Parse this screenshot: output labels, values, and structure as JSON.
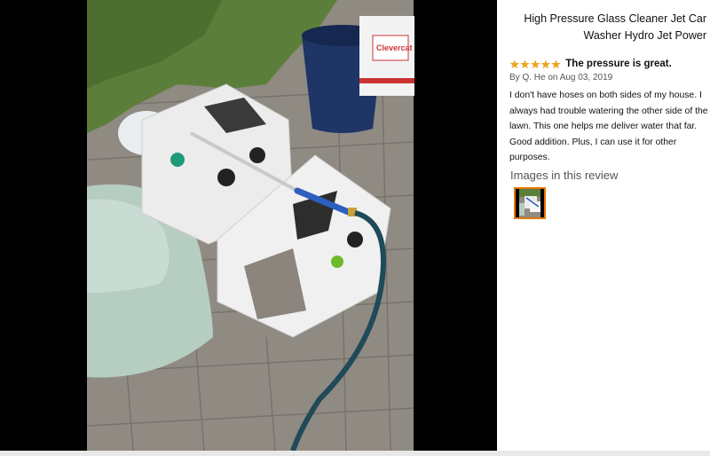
{
  "product": {
    "title": "High Pressure Glass Cleaner Jet Car Washer Hydro Jet Power"
  },
  "review": {
    "rating": 5,
    "rating_max": 5,
    "title": "The pressure is great.",
    "byline": "By Q. He on Aug 03, 2019",
    "body": "I don't have hoses on both sides of my house. I always had trouble watering the other side of the lawn. This one helps me deliver water that far. Good addition. Plus, I can use it for other purposes.",
    "star_color": "#f0a419"
  },
  "images_section": {
    "heading": "Images in this review",
    "selected_thumb_color": "#e77600"
  },
  "photo": {
    "bucket_label": "Clevercat"
  }
}
